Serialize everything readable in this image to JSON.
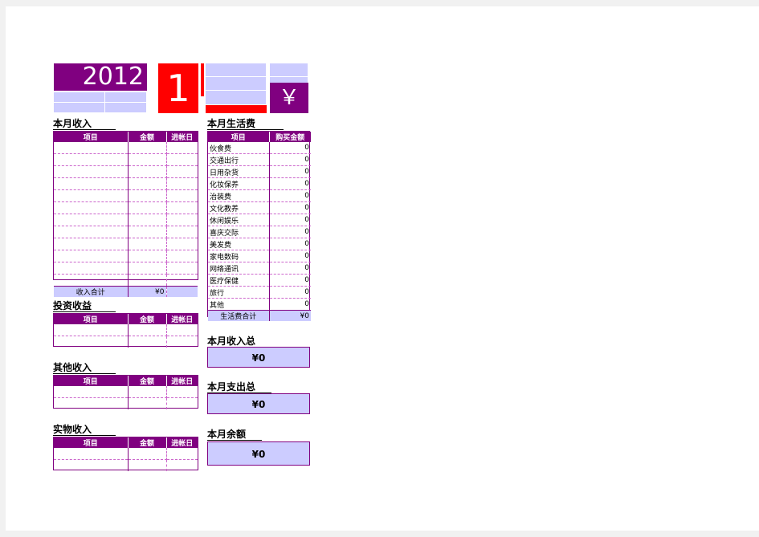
{
  "banner": {
    "year": "2012",
    "month": "1",
    "currency_symbol": "￥"
  },
  "income": {
    "title": "本月收入",
    "columns": [
      "项目",
      "金额",
      "进帐日"
    ],
    "rows": [
      [
        "",
        "",
        ""
      ],
      [
        "",
        "",
        ""
      ],
      [
        "",
        "",
        ""
      ],
      [
        "",
        "",
        ""
      ],
      [
        "",
        "",
        ""
      ],
      [
        "",
        "",
        ""
      ],
      [
        "",
        "",
        ""
      ],
      [
        "",
        "",
        ""
      ],
      [
        "",
        "",
        ""
      ],
      [
        "",
        "",
        ""
      ],
      [
        "",
        "",
        ""
      ],
      [
        "",
        "",
        ""
      ]
    ],
    "total_label": "收入合计",
    "total_value": "¥0"
  },
  "investment": {
    "title": "投资收益",
    "columns": [
      "项目",
      "金额",
      "进帐日"
    ],
    "rows": [
      [
        "",
        "",
        ""
      ],
      [
        "",
        "",
        ""
      ]
    ]
  },
  "other_income": {
    "title": "其他收入",
    "columns": [
      "项目",
      "金额",
      "进帐日"
    ],
    "rows": [
      [
        "",
        "",
        ""
      ],
      [
        "",
        "",
        ""
      ]
    ]
  },
  "goods_income": {
    "title": "实物收入",
    "columns": [
      "项目",
      "金额",
      "进帐日"
    ],
    "rows": [
      [
        "",
        "",
        ""
      ],
      [
        "",
        "",
        ""
      ]
    ]
  },
  "living_expense": {
    "title": "本月生活费",
    "columns": [
      "项目",
      "购买金额"
    ],
    "rows": [
      [
        "伙食费",
        "0"
      ],
      [
        "交通出行",
        "0"
      ],
      [
        "日用杂货",
        "0"
      ],
      [
        "化妆保养",
        "0"
      ],
      [
        "治装费",
        "0"
      ],
      [
        "文化教养",
        "0"
      ],
      [
        "休闲娱乐",
        "0"
      ],
      [
        "喜庆交际",
        "0"
      ],
      [
        "美发费",
        "0"
      ],
      [
        "家电数码",
        "0"
      ],
      [
        "网络通讯",
        "0"
      ],
      [
        "医疗保健",
        "0"
      ],
      [
        "旅行",
        "0"
      ],
      [
        "其他",
        "0"
      ]
    ],
    "total_label": "生活费合计",
    "total_value": "¥0"
  },
  "summary": {
    "income_total_label": "本月收入总",
    "income_total_value": "¥0",
    "expense_total_label": "本月支出总",
    "expense_total_value": "¥0",
    "balance_label": "本月余额",
    "balance_value": "¥0"
  },
  "colors": {
    "purple": "#800080",
    "lavender": "#ccccff",
    "red": "#ff0000",
    "grid_dash": "#cc66cc"
  }
}
